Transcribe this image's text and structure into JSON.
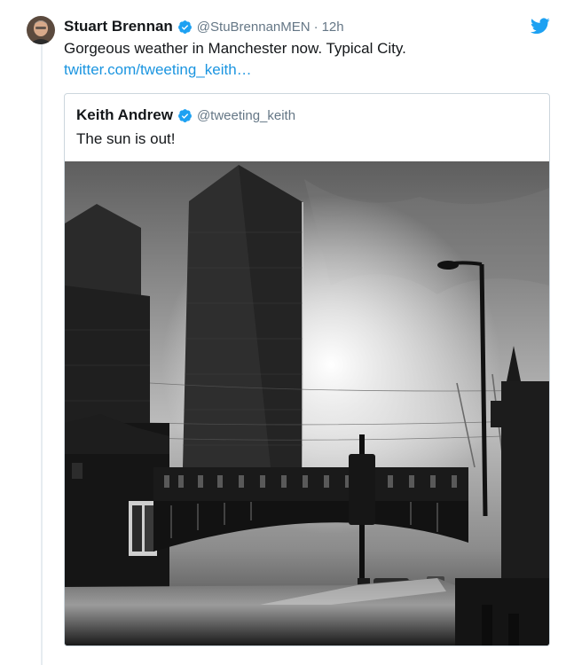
{
  "tweet": {
    "author_name": "Stuart Brennan",
    "author_handle": "@StuBrennanMEN",
    "separator": "·",
    "time": "12h",
    "text": "Gorgeous weather in Manchester now. Typical City.",
    "link_text": "twitter.com/tweeting_keith…",
    "verified_icon": "verified-badge-icon",
    "brand_icon": "twitter-bird-icon"
  },
  "quote": {
    "author_name": "Keith Andrew",
    "author_handle": "@tweeting_keith",
    "text": "The sun is out!",
    "photo_subject": "black-and-white Manchester skyline with tall towers, railway bridge and street lamp against a bright sun"
  },
  "colors": {
    "link_blue": "#1b95e0",
    "verified_blue": "#1da1f2",
    "secondary_text": "#657786",
    "border": "#ccd6dd"
  }
}
